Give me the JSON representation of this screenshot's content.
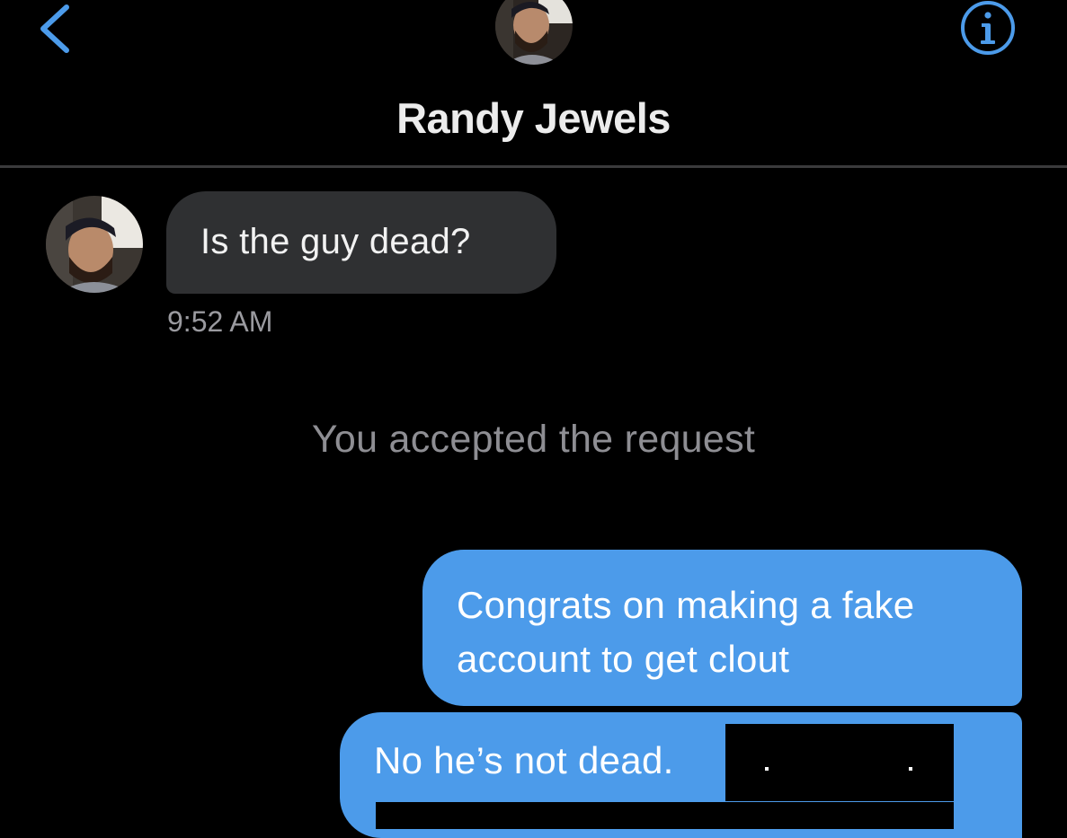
{
  "header": {
    "back_icon": "chevron-left-icon",
    "info_icon": "info-circle-icon",
    "contact_name": "Randy Jewels",
    "accent_color": "#4c9bea"
  },
  "conversation": {
    "incoming": [
      {
        "text": "Is the guy dead?",
        "time": "9:52 AM"
      }
    ],
    "system_note": "You accepted the request",
    "outgoing": [
      {
        "text": "Congrats on making a fake account to get clout"
      },
      {
        "text": "No he’s not dead."
      }
    ]
  },
  "colors": {
    "background": "#000000",
    "incoming_bubble": "#2f3032",
    "outgoing_bubble": "#4c9bea",
    "secondary_text": "#8e8e93"
  }
}
